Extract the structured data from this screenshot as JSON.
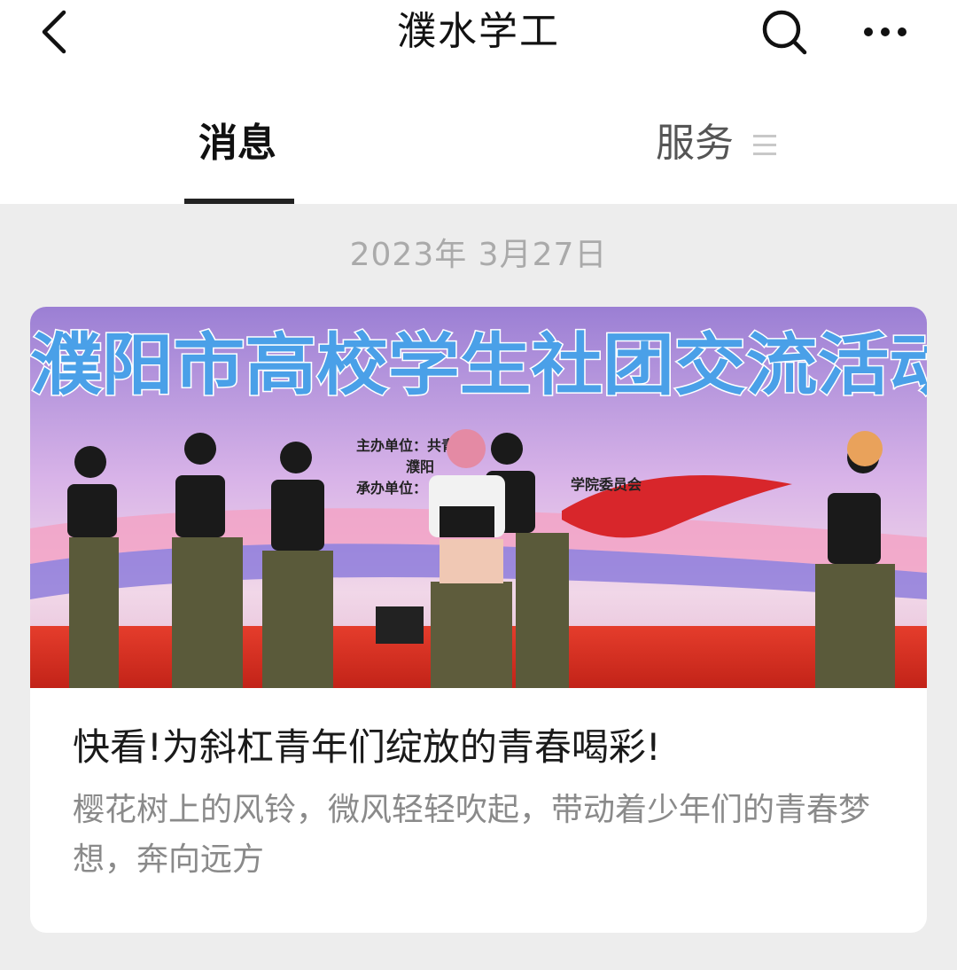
{
  "header": {
    "title": "濮水学工"
  },
  "tabs": [
    {
      "label": "消息",
      "active": true
    },
    {
      "label": "服务",
      "active": false
    }
  ],
  "feed": {
    "date": "2023年 3月27日",
    "article": {
      "title": "快看!为斜杠青年们绽放的青春喝彩!",
      "summary": "樱花树上的风铃，微风轻轻吹起，带动着少年们的青春梦想，奔向远方",
      "image": {
        "banner_text": "濮阳市高校学生社团交流活动",
        "sign_lines": [
          "主办单位：共青团",
          "濮阳",
          "承办单位：",
          "学院委员会"
        ]
      }
    }
  },
  "colors": {
    "background": "#ededed",
    "card": "#ffffff",
    "active_tab_underline": "#222222",
    "summary_text": "#8a8a8a"
  },
  "icons": {
    "back": "chevron-left-icon",
    "search": "search-icon",
    "more": "more-dots-icon",
    "menu": "menu-lines-icon"
  }
}
